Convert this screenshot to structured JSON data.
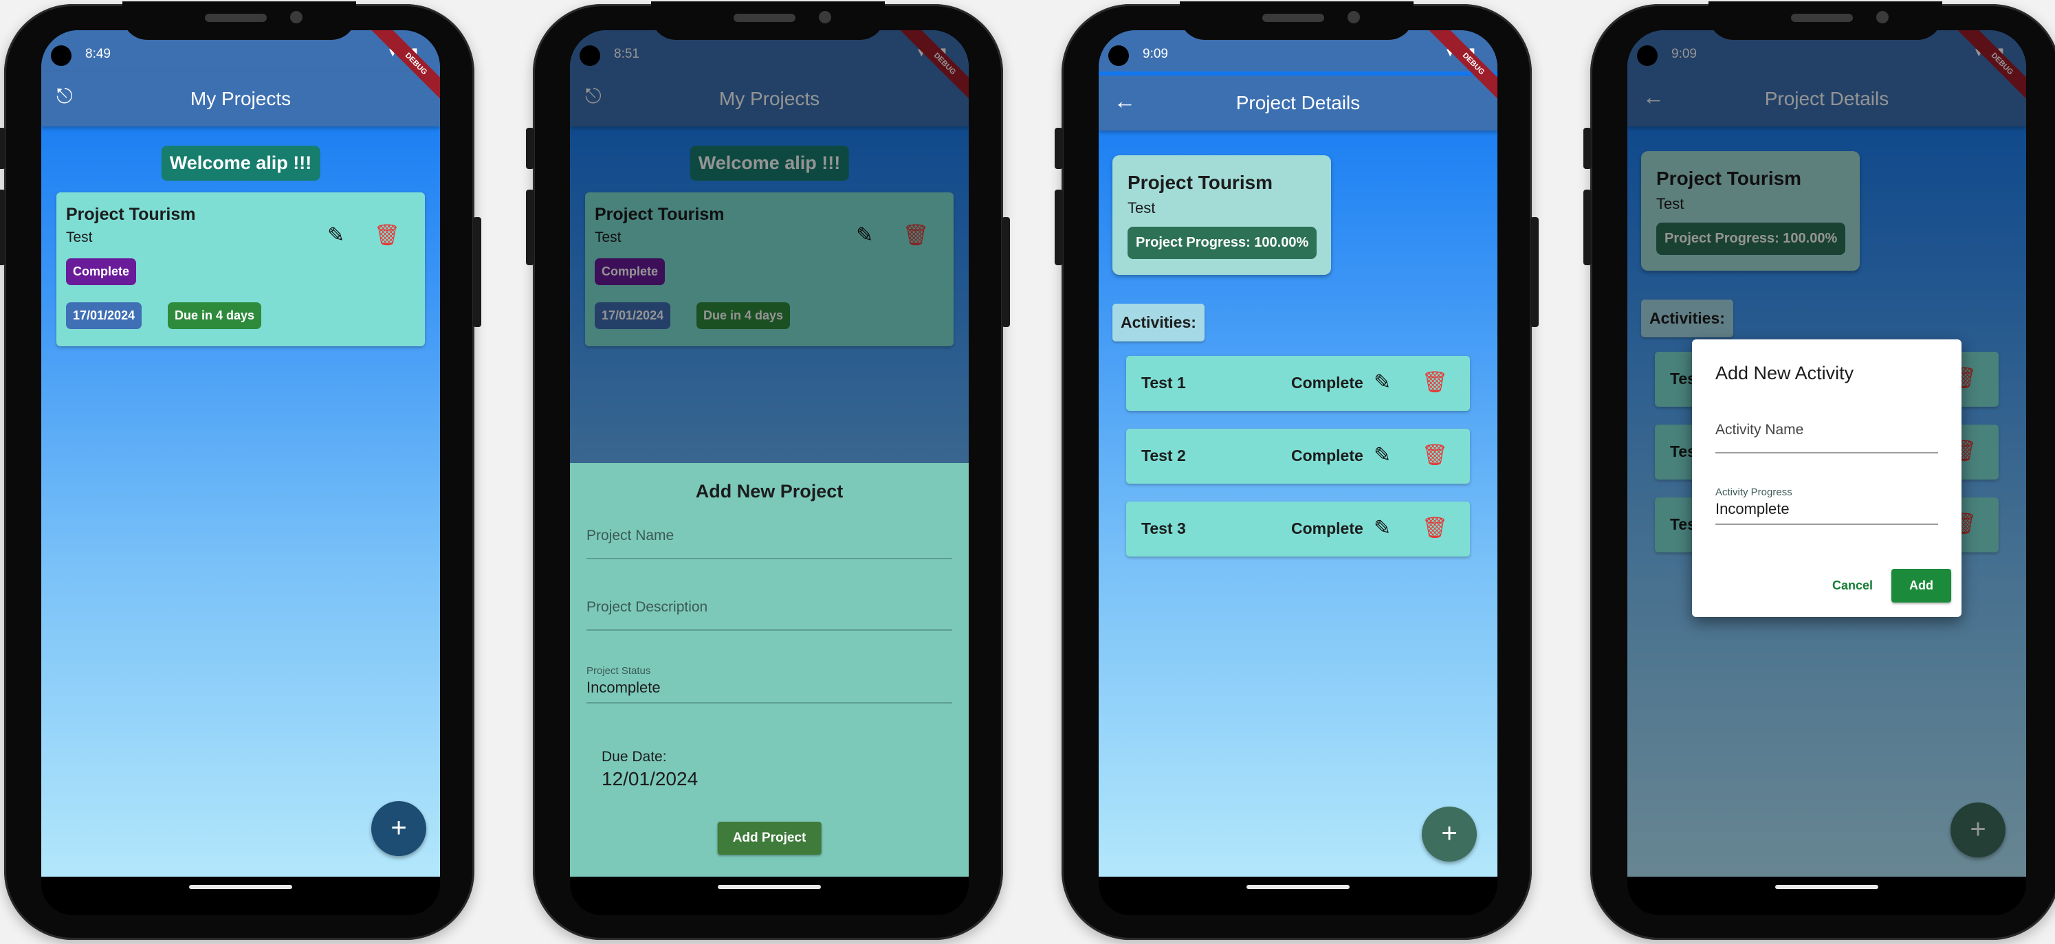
{
  "status_bar": {
    "phone1_time": "8:49",
    "phone2_time": "8:51",
    "phone3_time": "9:09",
    "phone4_time": "9:09",
    "icons": "▼◢▮"
  },
  "debug_ribbon": "DEBUG",
  "phone1": {
    "title": "My Projects",
    "logout_icon": "⎋",
    "welcome": "Welcome alip !!!",
    "project": {
      "name": "Project Tourism",
      "description": "Test",
      "status": "Complete",
      "date": "17/01/2024",
      "due": "Due in 4 days"
    },
    "fab": "+"
  },
  "phone2": {
    "title": "My Projects",
    "welcome": "Welcome alip !!!",
    "project": {
      "name": "Project Tourism",
      "description": "Test",
      "status": "Complete",
      "date": "17/01/2024",
      "due": "Due in 4 days"
    },
    "sheet": {
      "title": "Add New Project",
      "name_placeholder": "Project Name",
      "desc_placeholder": "Project Description",
      "status_label": "Project Status",
      "status_value": "Incomplete",
      "due_label": "Due Date:",
      "due_value": "12/01/2024",
      "submit": "Add Project"
    }
  },
  "phone3": {
    "title": "Project Details",
    "project": {
      "name": "Project Tourism",
      "description": "Test",
      "progress": "Project Progress: 100.00%"
    },
    "activities_label": "Activities:",
    "activities": [
      {
        "name": "Test 1",
        "status": "Complete"
      },
      {
        "name": "Test 2",
        "status": "Complete"
      },
      {
        "name": "Test 3",
        "status": "Complete"
      }
    ],
    "fab": "+"
  },
  "phone4": {
    "title": "Project Details",
    "project": {
      "name": "Project Tourism",
      "description": "Test",
      "progress": "Project Progress: 100.00%"
    },
    "activities_label": "Activities:",
    "activity_stubs": [
      "Tes",
      "Tes",
      "Tes"
    ],
    "dialog": {
      "title": "Add New Activity",
      "name_placeholder": "Activity Name",
      "progress_label": "Activity Progress",
      "progress_value": "Incomplete",
      "cancel": "Cancel",
      "add": "Add"
    },
    "fab": "+"
  },
  "colors": {
    "appbar": "#3d70b1",
    "card": "#7fded4",
    "complete_chip": "#6a1b9a",
    "date_chip": "#3f6fb5",
    "due_chip": "#2e8b3c",
    "delete": "#e53935",
    "fab": "#1e4d74"
  }
}
